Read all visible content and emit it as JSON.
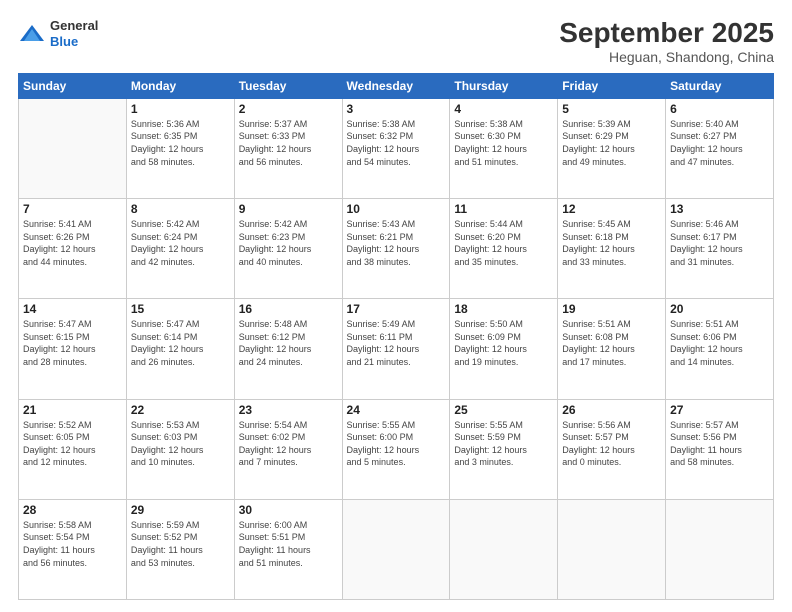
{
  "logo": {
    "line1": "General",
    "line2": "Blue"
  },
  "title": "September 2025",
  "subtitle": "Heguan, Shandong, China",
  "days_header": [
    "Sunday",
    "Monday",
    "Tuesday",
    "Wednesday",
    "Thursday",
    "Friday",
    "Saturday"
  ],
  "weeks": [
    [
      {
        "day": "",
        "info": ""
      },
      {
        "day": "1",
        "info": "Sunrise: 5:36 AM\nSunset: 6:35 PM\nDaylight: 12 hours\nand 58 minutes."
      },
      {
        "day": "2",
        "info": "Sunrise: 5:37 AM\nSunset: 6:33 PM\nDaylight: 12 hours\nand 56 minutes."
      },
      {
        "day": "3",
        "info": "Sunrise: 5:38 AM\nSunset: 6:32 PM\nDaylight: 12 hours\nand 54 minutes."
      },
      {
        "day": "4",
        "info": "Sunrise: 5:38 AM\nSunset: 6:30 PM\nDaylight: 12 hours\nand 51 minutes."
      },
      {
        "day": "5",
        "info": "Sunrise: 5:39 AM\nSunset: 6:29 PM\nDaylight: 12 hours\nand 49 minutes."
      },
      {
        "day": "6",
        "info": "Sunrise: 5:40 AM\nSunset: 6:27 PM\nDaylight: 12 hours\nand 47 minutes."
      }
    ],
    [
      {
        "day": "7",
        "info": "Sunrise: 5:41 AM\nSunset: 6:26 PM\nDaylight: 12 hours\nand 44 minutes."
      },
      {
        "day": "8",
        "info": "Sunrise: 5:42 AM\nSunset: 6:24 PM\nDaylight: 12 hours\nand 42 minutes."
      },
      {
        "day": "9",
        "info": "Sunrise: 5:42 AM\nSunset: 6:23 PM\nDaylight: 12 hours\nand 40 minutes."
      },
      {
        "day": "10",
        "info": "Sunrise: 5:43 AM\nSunset: 6:21 PM\nDaylight: 12 hours\nand 38 minutes."
      },
      {
        "day": "11",
        "info": "Sunrise: 5:44 AM\nSunset: 6:20 PM\nDaylight: 12 hours\nand 35 minutes."
      },
      {
        "day": "12",
        "info": "Sunrise: 5:45 AM\nSunset: 6:18 PM\nDaylight: 12 hours\nand 33 minutes."
      },
      {
        "day": "13",
        "info": "Sunrise: 5:46 AM\nSunset: 6:17 PM\nDaylight: 12 hours\nand 31 minutes."
      }
    ],
    [
      {
        "day": "14",
        "info": "Sunrise: 5:47 AM\nSunset: 6:15 PM\nDaylight: 12 hours\nand 28 minutes."
      },
      {
        "day": "15",
        "info": "Sunrise: 5:47 AM\nSunset: 6:14 PM\nDaylight: 12 hours\nand 26 minutes."
      },
      {
        "day": "16",
        "info": "Sunrise: 5:48 AM\nSunset: 6:12 PM\nDaylight: 12 hours\nand 24 minutes."
      },
      {
        "day": "17",
        "info": "Sunrise: 5:49 AM\nSunset: 6:11 PM\nDaylight: 12 hours\nand 21 minutes."
      },
      {
        "day": "18",
        "info": "Sunrise: 5:50 AM\nSunset: 6:09 PM\nDaylight: 12 hours\nand 19 minutes."
      },
      {
        "day": "19",
        "info": "Sunrise: 5:51 AM\nSunset: 6:08 PM\nDaylight: 12 hours\nand 17 minutes."
      },
      {
        "day": "20",
        "info": "Sunrise: 5:51 AM\nSunset: 6:06 PM\nDaylight: 12 hours\nand 14 minutes."
      }
    ],
    [
      {
        "day": "21",
        "info": "Sunrise: 5:52 AM\nSunset: 6:05 PM\nDaylight: 12 hours\nand 12 minutes."
      },
      {
        "day": "22",
        "info": "Sunrise: 5:53 AM\nSunset: 6:03 PM\nDaylight: 12 hours\nand 10 minutes."
      },
      {
        "day": "23",
        "info": "Sunrise: 5:54 AM\nSunset: 6:02 PM\nDaylight: 12 hours\nand 7 minutes."
      },
      {
        "day": "24",
        "info": "Sunrise: 5:55 AM\nSunset: 6:00 PM\nDaylight: 12 hours\nand 5 minutes."
      },
      {
        "day": "25",
        "info": "Sunrise: 5:55 AM\nSunset: 5:59 PM\nDaylight: 12 hours\nand 3 minutes."
      },
      {
        "day": "26",
        "info": "Sunrise: 5:56 AM\nSunset: 5:57 PM\nDaylight: 12 hours\nand 0 minutes."
      },
      {
        "day": "27",
        "info": "Sunrise: 5:57 AM\nSunset: 5:56 PM\nDaylight: 11 hours\nand 58 minutes."
      }
    ],
    [
      {
        "day": "28",
        "info": "Sunrise: 5:58 AM\nSunset: 5:54 PM\nDaylight: 11 hours\nand 56 minutes."
      },
      {
        "day": "29",
        "info": "Sunrise: 5:59 AM\nSunset: 5:52 PM\nDaylight: 11 hours\nand 53 minutes."
      },
      {
        "day": "30",
        "info": "Sunrise: 6:00 AM\nSunset: 5:51 PM\nDaylight: 11 hours\nand 51 minutes."
      },
      {
        "day": "",
        "info": ""
      },
      {
        "day": "",
        "info": ""
      },
      {
        "day": "",
        "info": ""
      },
      {
        "day": "",
        "info": ""
      }
    ]
  ]
}
